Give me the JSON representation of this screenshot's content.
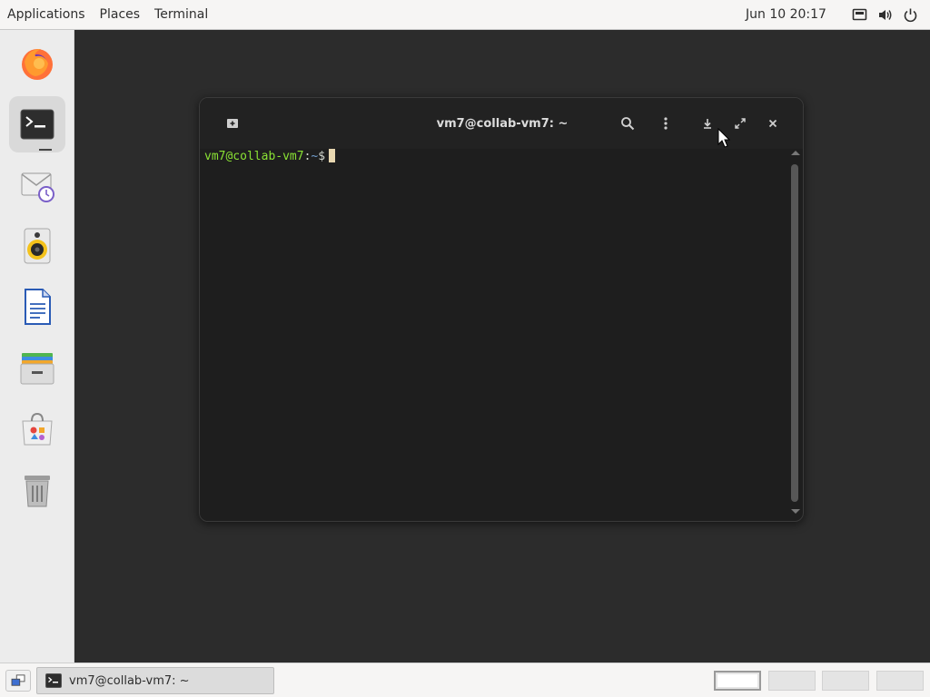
{
  "top_panel": {
    "menus": [
      "Applications",
      "Places",
      "Terminal"
    ],
    "clock": "Jun 10  20:17",
    "tray": [
      "display-icon",
      "volume-icon",
      "power-icon"
    ]
  },
  "dock": {
    "items": [
      {
        "name": "firefox-icon",
        "active": false
      },
      {
        "name": "terminal-icon",
        "active": true
      },
      {
        "name": "mail-client-icon",
        "active": false
      },
      {
        "name": "music-player-icon",
        "active": false
      },
      {
        "name": "writer-document-icon",
        "active": false
      },
      {
        "name": "file-manager-icon",
        "active": false
      },
      {
        "name": "software-store-icon",
        "active": false
      },
      {
        "name": "trash-icon",
        "active": false
      }
    ]
  },
  "terminal": {
    "title": "vm7@collab-vm7: ~",
    "prompt_user_host": "vm7@collab-vm7",
    "prompt_sep": ":",
    "prompt_path": "~",
    "prompt_symbol": "$",
    "toolbar_icons": [
      "new-tab-icon",
      "search-icon",
      "menu-icon",
      "minimize-icon",
      "maximize-icon",
      "close-icon"
    ]
  },
  "taskbar": {
    "task_label": "vm7@collab-vm7: ~",
    "workspaces": 4,
    "current_workspace": 1
  },
  "colors": {
    "prompt_user": "#8ae234",
    "prompt_path": "#729fcf",
    "cursor": "#e8d7b0",
    "window_bg": "#1e1e1e"
  }
}
